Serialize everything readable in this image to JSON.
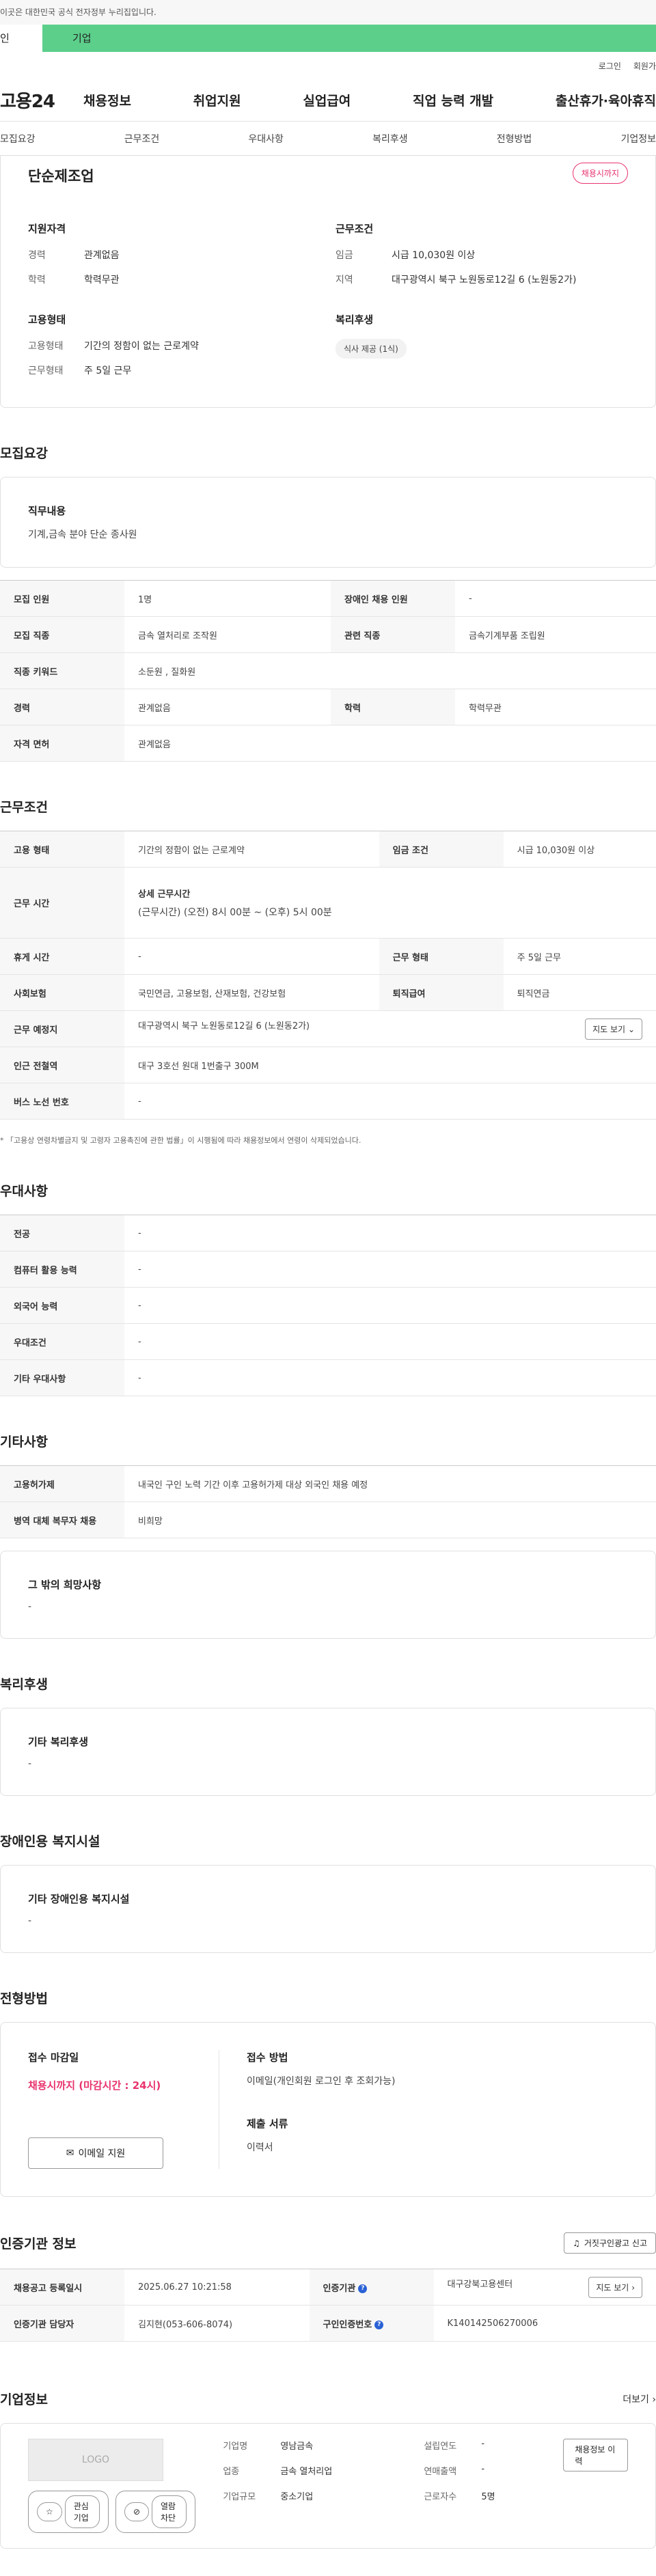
{
  "header": {
    "topnote": "이곳은 대한민국 공식 전자정부 누리집입니다.",
    "tabs": [
      "인",
      "기업"
    ],
    "utility": [
      "로그인",
      "회원가"
    ],
    "logo": "고용24",
    "gnb": [
      "채용정보",
      "취업지원",
      "실업급여",
      "직업 능력 개발",
      "출산휴가·육아휴직"
    ]
  },
  "subtabs": [
    "모집요강",
    "근무조건",
    "우대사항",
    "복리후생",
    "전형방법",
    "기업정보"
  ],
  "summary": {
    "title": "단순제조업",
    "badge": "채용시까지",
    "qual_h": "지원자격",
    "qual": [
      {
        "k": "경력",
        "v": "관계없음"
      },
      {
        "k": "학력",
        "v": "학력무관"
      }
    ],
    "cond_h": "근무조건",
    "cond": [
      {
        "k": "임금",
        "v": "시급 10,030원 이상"
      },
      {
        "k": "지역",
        "v": "대구광역시 북구 노원동로12길 6 (노원동2가)"
      }
    ],
    "emp_h": "고용형태",
    "emp": [
      {
        "k": "고용형태",
        "v": "기간의 정함이 없는 근로계약"
      },
      {
        "k": "근무형태",
        "v": "주 5일 근무"
      }
    ],
    "benefit_h": "복리후생",
    "benefit_chip": "식사 제공 (1식)"
  },
  "recruit": {
    "title": "모집요강",
    "duty_h": "직무내용",
    "duty_v": "기계,금속 분야 단순 종사원",
    "rows": {
      "r1": [
        "모집 인원",
        "1명",
        "장애인 채용 인원",
        "-"
      ],
      "r2": [
        "모집 직종",
        "금속 열처리로 조작원",
        "관련 직종",
        "금속기계부품 조립원"
      ],
      "r3": [
        "직종 키워드",
        "소둔원 , 질화원"
      ],
      "r4": [
        "경력",
        "관계없음",
        "학력",
        "학력무관"
      ],
      "r5": [
        "자격 면허",
        "관계없음"
      ]
    }
  },
  "work": {
    "title": "근무조건",
    "r1": [
      "고용 형태",
      "기간의 정함이 없는 근로계약",
      "임금 조건",
      "시급 10,030원 이상"
    ],
    "time_k": "근무 시간",
    "time_h": "상세 근무시간",
    "time_v": "(근무시간) (오전) 8시 00분 ~ (오후) 5시 00분",
    "r3": [
      "휴게 시간",
      "-",
      "근무 형태",
      "주 5일 근무"
    ],
    "r4": [
      "사회보험",
      "국민연금, 고용보험, 산재보험, 건강보험",
      "퇴직급여",
      "퇴직연금"
    ],
    "r5": [
      "근무 예정지",
      "대구광역시 북구 노원동로12길 6 (노원동2가)"
    ],
    "map_btn": "지도 보기",
    "r6": [
      "인근 전철역",
      "대구 3호선 원대 1번출구 300M"
    ],
    "r7": [
      "버스 노선 번호",
      "-"
    ],
    "footnote": "「고용상 연령차별금지 및 고령자 고용촉진에 관한 법률」이 시행됨에 따라 채용정보에서 연령이 삭제되었습니다."
  },
  "prefer": {
    "title": "우대사항",
    "rows": [
      [
        "전공",
        "-"
      ],
      [
        "컴퓨터 활용 능력",
        "-"
      ],
      [
        "외국어 능력",
        "-"
      ],
      [
        "우대조건",
        "-"
      ],
      [
        "기타 우대사항",
        "-"
      ]
    ]
  },
  "etc": {
    "title": "기타사항",
    "rows": [
      [
        "고용허가제",
        "내국인 구인 노력 기간 이후 고용허가제 대상 외국인 채용 예정"
      ],
      [
        "병역 대체 복무자 채용",
        "비희망"
      ]
    ],
    "box_h": "그 밖의 희망사항",
    "box_v": "-"
  },
  "welfare": {
    "title": "복리후생",
    "box_h": "기타 복리후생",
    "box_v": "-"
  },
  "disabled": {
    "title": "장애인용 복지시설",
    "box_h": "기타 장애인용 복지시설",
    "box_v": "-"
  },
  "apply": {
    "title": "전형방법",
    "deadline_h": "접수 마감일",
    "deadline_v": "채용시까지 (마감시간 : 24시)",
    "email_btn": "이메일 지원",
    "method_h": "접수 방법",
    "method_v": "이메일(개인회원 로그인 후 조회가능)",
    "docs_h": "제출 서류",
    "docs_v": "이력서"
  },
  "cert": {
    "title": "인증기관 정보",
    "report_btn": "거짓구인광고 신고",
    "r1": [
      "채용공고 등록일시",
      "2025.06.27 10:21:58",
      "인증기관",
      "대구강북고용센터"
    ],
    "r2": [
      "인증기관 담당자",
      "김지현(053-606-8074)",
      "구인인증번호",
      "K140142506270006"
    ],
    "view_btn": "지도 보기"
  },
  "company": {
    "title": "기업정보",
    "more": "더보기",
    "logo": "LOGO",
    "fav": "관심기업",
    "block": "열람차단",
    "grid": [
      [
        "기업명",
        "영남금속",
        "설립연도",
        "-"
      ],
      [
        "업종",
        "금속 열처리업",
        "연매출액",
        "-"
      ],
      [
        "기업규모",
        "중소기업",
        "근로자수",
        "5명"
      ]
    ],
    "history_btn": "채용정보 이력"
  }
}
